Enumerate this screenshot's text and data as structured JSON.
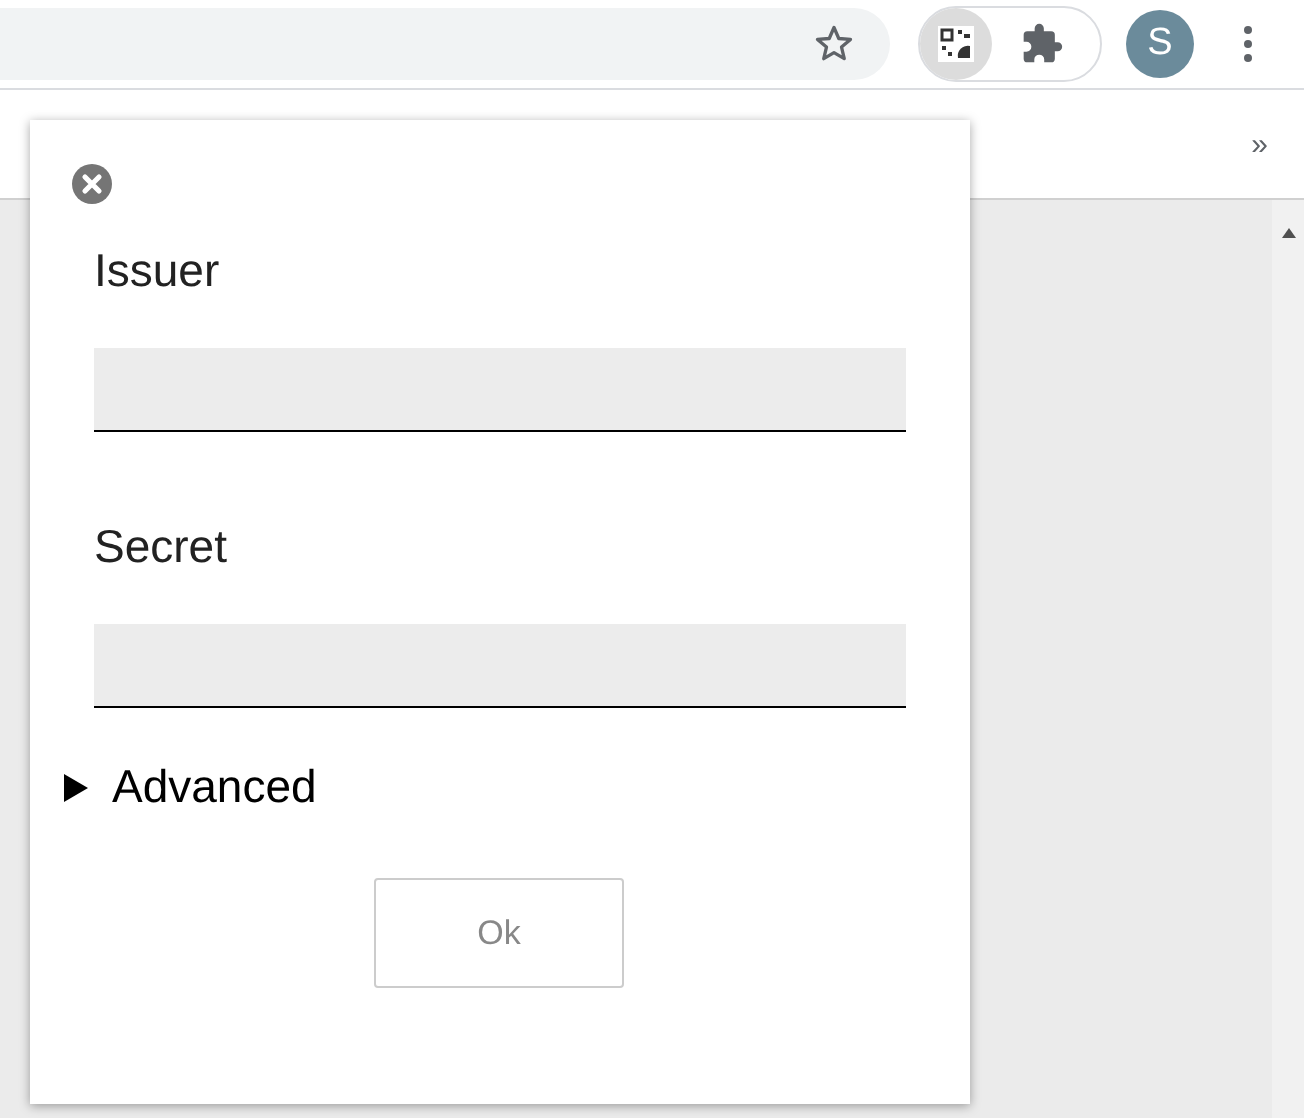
{
  "toolbar": {
    "avatar_letter": "S"
  },
  "bookmarks_bar": {
    "overflow": "»"
  },
  "popup": {
    "fields": [
      {
        "label": "Issuer"
      },
      {
        "label": "Secret"
      }
    ],
    "advanced": {
      "label": "Advanced",
      "expanded": false
    },
    "ok_button": {
      "label": "Ok",
      "disabled": true
    }
  }
}
